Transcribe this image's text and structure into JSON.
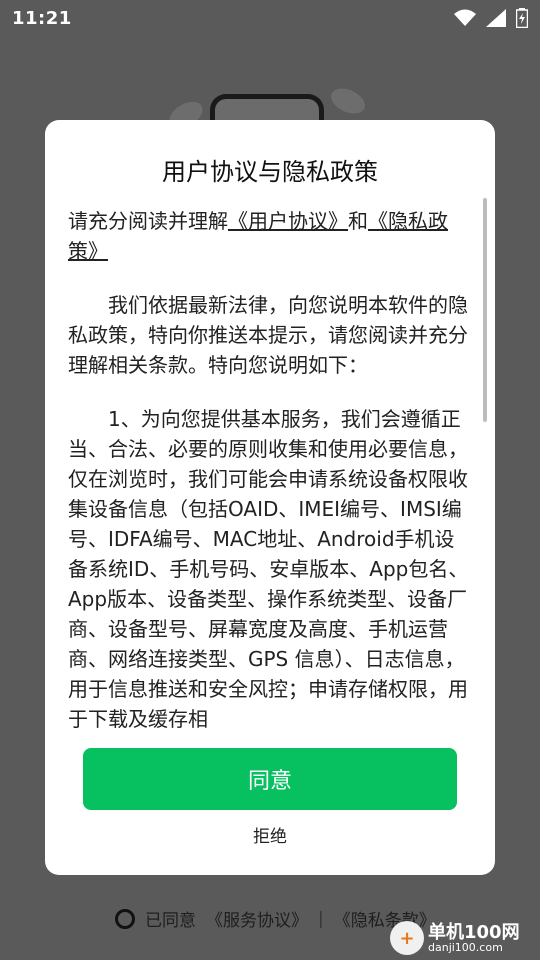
{
  "status_bar": {
    "time": "11:21",
    "icons": [
      "wifi-icon",
      "signal-icon",
      "battery-charging-icon"
    ]
  },
  "dialog": {
    "title": "用户协议与隐私政策",
    "intro_prefix": "请充分阅读并理解",
    "link_user_agreement": "《用户协议》",
    "intro_and": "和",
    "link_privacy_policy": "《隐私政策》",
    "paragraph1": "我们依据最新法律，向您说明本软件的隐私政策，特向你推送本提示，请您阅读并充分理解相关条款。特向您说明如下：",
    "paragraph2": "1、为向您提供基本服务，我们会遵循正当、合法、必要的原则收集和使用必要信息，仅在浏览时，我们可能会申请系统设备权限收集设备信息（包括OAID、IMEI编号、IMSI编号、IDFA编号、MAC地址、Android手机设备系统ID、手机号码、安卓版本、App包名、App版本、设备类型、操作系统类型、设备厂商、设备型号、屏幕宽度及高度、手机运营商、网络连接类型、GPS 信息）、日志信息，用于信息推送和安全风控；申请存储权限，用于下载及缓存相",
    "agree_label": "同意",
    "reject_label": "拒绝"
  },
  "bottom": {
    "agreed_text": "已同意",
    "service_agreement": "《服务协议》",
    "separator": "|",
    "privacy_terms": "《隐私条款》"
  },
  "watermark": {
    "main": "单机100网",
    "sub": "danji100.com"
  },
  "colors": {
    "accent": "#07c160",
    "overlay": "#5a5a5a"
  }
}
